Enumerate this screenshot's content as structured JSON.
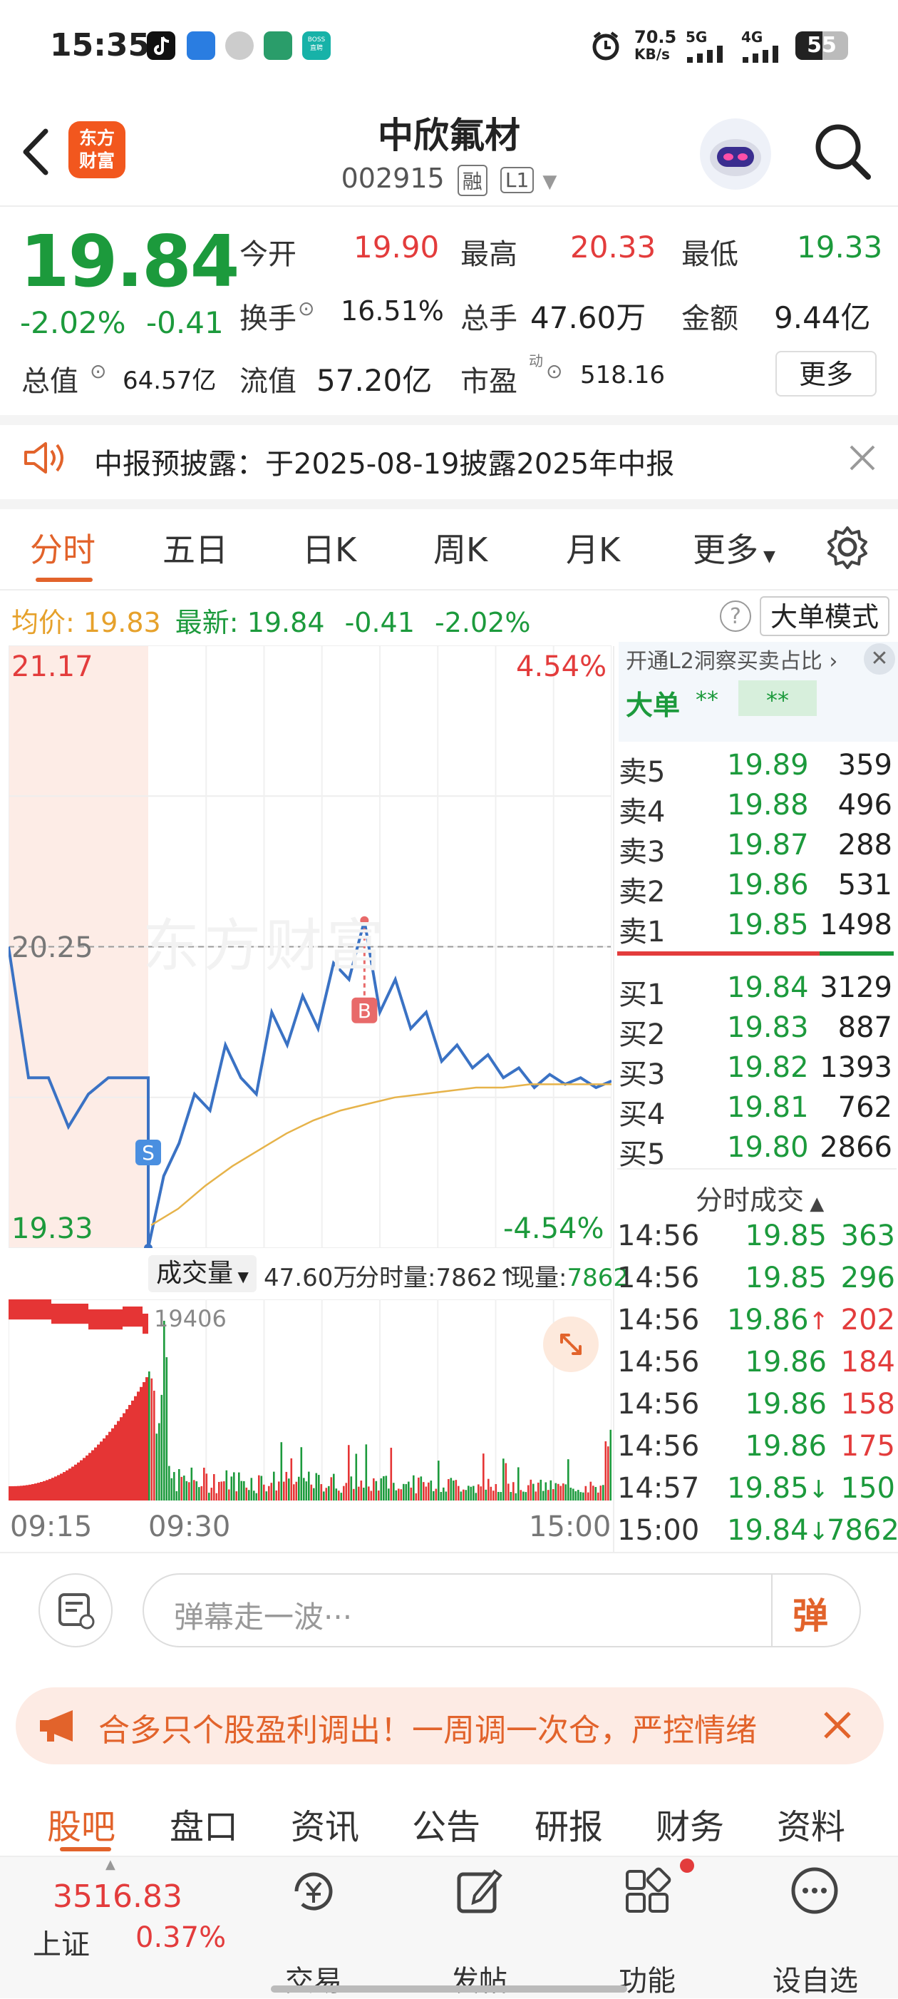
{
  "status_bar": {
    "time": "15:35",
    "net_speed_value": "70.5",
    "net_speed_unit": "KB/s",
    "sig1": "5G",
    "sig2": "4G",
    "battery": "55",
    "boss_app": "BOSS\n直聘"
  },
  "header": {
    "logo_line1": "东方",
    "logo_line2": "财富",
    "title": "中欣氟材",
    "code": "002915",
    "tag1": "融",
    "tag2": "L1"
  },
  "quote": {
    "price": "19.84",
    "change_pct": "-2.02%",
    "change": "-0.41",
    "open_label": "今开",
    "open": "19.90",
    "high_label": "最高",
    "high": "20.33",
    "low_label": "最低",
    "low": "19.33",
    "turnover_label": "换手",
    "turnover": "16.51%",
    "volume_label": "总手",
    "volume": "47.60万",
    "amount_label": "金额",
    "amount": "9.44亿",
    "mcap_label": "总值",
    "mcap": "64.57亿",
    "float_label": "流值",
    "float": "57.20亿",
    "pe_label": "市盈",
    "pe_sup": "动",
    "pe": "518.16",
    "more": "更多"
  },
  "notice": {
    "text": "中报预披露：于2025-08-19披露2025年中报"
  },
  "tabs": [
    "分时",
    "五日",
    "日K",
    "周K",
    "月K",
    "更多"
  ],
  "info_line": {
    "avg_label": "均价:",
    "avg": "19.83",
    "latest_label": "最新:",
    "latest": "19.84",
    "change": "-0.41",
    "change_pct": "-2.02%",
    "mode_button": "大单模式"
  },
  "chart_data": {
    "type": "line",
    "y_max_label": "21.17",
    "y_ref_label": "20.25",
    "y_min_label": "19.33",
    "pct_max_label": "4.54%",
    "pct_min_label": "-4.54%",
    "x_labels": [
      "09:15",
      "09:30",
      "15:00"
    ],
    "ylim": [
      19.33,
      21.17
    ],
    "reference": 20.25,
    "watermark": "东方财富",
    "markers": [
      {
        "label": "B",
        "price": 20.33
      },
      {
        "label": "S",
        "price": 19.33
      }
    ],
    "series": [
      {
        "name": "price",
        "values": [
          20.25,
          19.85,
          19.85,
          19.7,
          19.8,
          19.85,
          19.85,
          19.85,
          19.33,
          19.55,
          19.65,
          19.8,
          19.75,
          19.95,
          19.85,
          19.8,
          20.05,
          19.95,
          20.1,
          20.0,
          20.2,
          20.15,
          20.33,
          20.05,
          20.15,
          20.0,
          20.05,
          19.9,
          19.95,
          19.88,
          19.92,
          19.85,
          19.88,
          19.82,
          19.86,
          19.83,
          19.85,
          19.82,
          19.84
        ]
      },
      {
        "name": "avg",
        "values": [
          19.4,
          19.45,
          19.52,
          19.58,
          19.63,
          19.68,
          19.72,
          19.75,
          19.77,
          19.79,
          19.8,
          19.81,
          19.82,
          19.82,
          19.83,
          19.83,
          19.83,
          19.83
        ]
      }
    ],
    "volume": {
      "label": "成交量",
      "total": "47.60万",
      "minute_label": "分时量:",
      "minute": "7862",
      "current_label": "现量:",
      "current": "7862",
      "peak": "19406"
    }
  },
  "order_book": {
    "header": "开通L2洞察买卖占比",
    "big_label": "大单",
    "big_val1": "**",
    "big_val2": "**",
    "asks": [
      {
        "label": "卖5",
        "price": "19.89",
        "vol": "359"
      },
      {
        "label": "卖4",
        "price": "19.88",
        "vol": "496"
      },
      {
        "label": "卖3",
        "price": "19.87",
        "vol": "288"
      },
      {
        "label": "卖2",
        "price": "19.86",
        "vol": "531"
      },
      {
        "label": "卖1",
        "price": "19.85",
        "vol": "1498"
      }
    ],
    "bids": [
      {
        "label": "买1",
        "price": "19.84",
        "vol": "3129"
      },
      {
        "label": "买2",
        "price": "19.83",
        "vol": "887"
      },
      {
        "label": "买3",
        "price": "19.82",
        "vol": "1393"
      },
      {
        "label": "买4",
        "price": "19.81",
        "vol": "762"
      },
      {
        "label": "买5",
        "price": "19.80",
        "vol": "2866"
      }
    ]
  },
  "trades": {
    "header": "分时成交",
    "rows": [
      {
        "time": "14:56",
        "price": "19.85",
        "arrow": "",
        "vol": "363",
        "color": "#1c9a3c"
      },
      {
        "time": "14:56",
        "price": "19.85",
        "arrow": "",
        "vol": "296",
        "color": "#1c9a3c"
      },
      {
        "time": "14:56",
        "price": "19.86",
        "arrow": "↑",
        "vol": "202",
        "color": "#e33c3c"
      },
      {
        "time": "14:56",
        "price": "19.86",
        "arrow": "",
        "vol": "184",
        "color": "#e33c3c"
      },
      {
        "time": "14:56",
        "price": "19.86",
        "arrow": "",
        "vol": "158",
        "color": "#e33c3c"
      },
      {
        "time": "14:56",
        "price": "19.86",
        "arrow": "",
        "vol": "175",
        "color": "#e33c3c"
      },
      {
        "time": "14:57",
        "price": "19.85",
        "arrow": "↓",
        "vol": "150",
        "color": "#1c9a3c"
      },
      {
        "time": "15:00",
        "price": "19.84",
        "arrow": "↓",
        "vol": "7862",
        "color": "#1c9a3c"
      }
    ]
  },
  "danmaku": {
    "placeholder": "弹幕走一波···",
    "button": "弹"
  },
  "ad": {
    "text": "合多只个股盈利调出！一周调一次仓，严控情绪"
  },
  "bottom_tabs": [
    "股吧",
    "盘口",
    "资讯",
    "公告",
    "研报",
    "财务",
    "资料"
  ],
  "nav": {
    "index_value": "3516.83",
    "index_name": "上证",
    "index_change": "0.37%",
    "items": [
      "交易",
      "发帖",
      "功能",
      "设自选"
    ]
  },
  "colors": {
    "up": "#e33c3c",
    "down": "#1c9a3c",
    "accent": "#e2632b",
    "price_line": "#3a72c4",
    "avg_line": "#e6b34a"
  }
}
